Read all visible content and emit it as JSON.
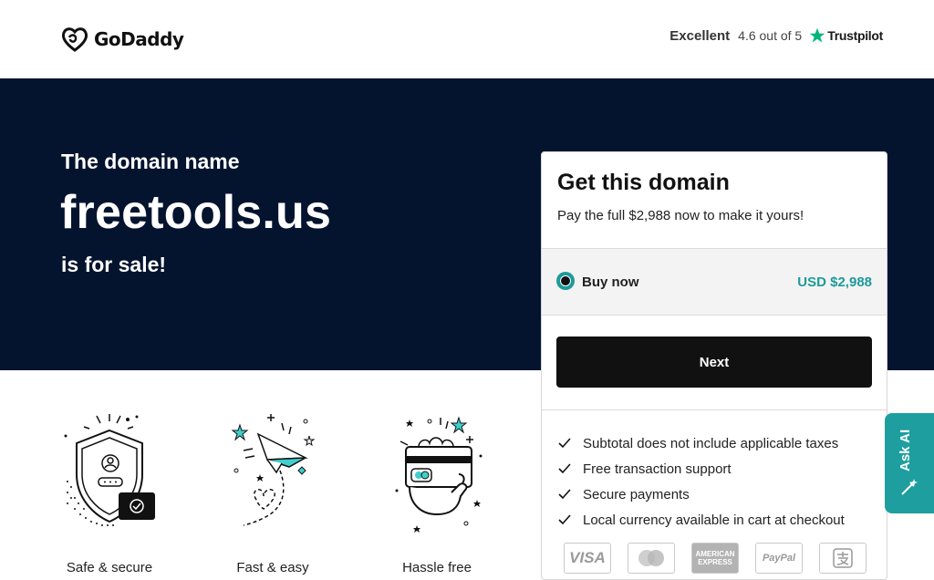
{
  "header": {
    "logo_text": "GoDaddy",
    "rating_label": "Excellent",
    "rating_score": "4.6 out of 5",
    "trustpilot": "Trustpilot"
  },
  "hero": {
    "kicker": "The domain name",
    "domain": "freetools.us",
    "sale": "is for sale!"
  },
  "card": {
    "title": "Get this domain",
    "subtitle": "Pay the full $2,988 now to make it yours!",
    "option_label": "Buy now",
    "option_price": "USD $2,988",
    "next_label": "Next",
    "features": [
      "Subtotal does not include applicable taxes",
      "Free transaction support",
      "Secure payments",
      "Local currency available in cart at checkout"
    ],
    "payments": {
      "visa": "VISA",
      "amex": "AMERICAN EXPRESS",
      "paypal": "PayPal"
    }
  },
  "benefits": [
    {
      "label": "Safe & secure"
    },
    {
      "label": "Fast & easy"
    },
    {
      "label": "Hassle free"
    }
  ],
  "ask_ai": "Ask AI",
  "colors": {
    "hero_bg": "#04142f",
    "accent": "#1e9a9b",
    "button": "#111111"
  }
}
